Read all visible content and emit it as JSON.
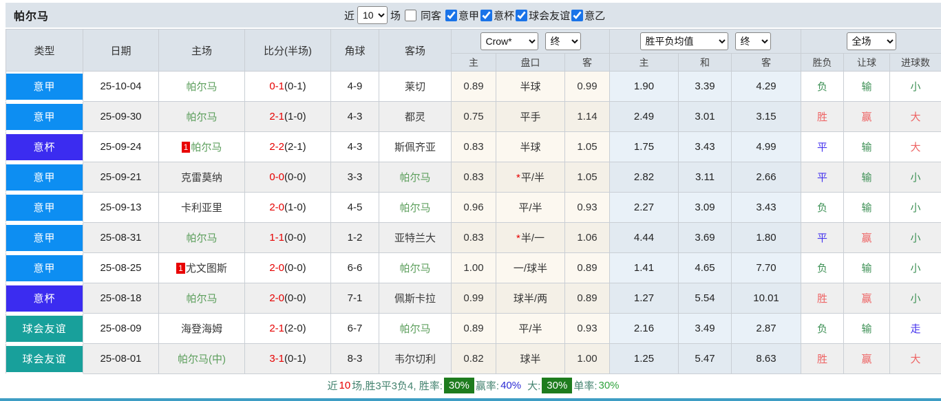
{
  "title": "帕尔马",
  "topbar": {
    "recent_label": "近",
    "recent_value": "10",
    "matches_label": "场",
    "same_away_label": "同客",
    "same_away_checked": false,
    "leagues": [
      {
        "label": "意甲",
        "checked": true
      },
      {
        "label": "意杯",
        "checked": true
      },
      {
        "label": "球会友谊",
        "checked": true
      },
      {
        "label": "意乙",
        "checked": true
      }
    ]
  },
  "table": {
    "selects": {
      "odds_source": "Crow*",
      "odds_time": "终",
      "avg_label": "胜平负均值",
      "avg_time": "终",
      "scope": "全场"
    },
    "headers": [
      "类型",
      "日期",
      "主场",
      "比分(半场)",
      "角球",
      "客场"
    ],
    "sub": [
      "主",
      "盘口",
      "客",
      "主",
      "和",
      "客",
      "胜负",
      "让球",
      "进球数"
    ],
    "rows": [
      {
        "type": "意甲",
        "type_color": "league_blue",
        "date": "25-10-04",
        "home": "帕尔马",
        "home_green": true,
        "home_badge": "",
        "score_ft": "0-1",
        "score_ht": "(0-1)",
        "corner": "4-9",
        "away": "莱切",
        "away_green": false,
        "odds_home": "0.89",
        "handicap": "半球",
        "handicap_star": false,
        "odds_away": "0.99",
        "avg_home": "1.90",
        "avg_draw": "3.39",
        "avg_away": "4.29",
        "result": "负",
        "result_color": "result_green",
        "let_result": "输",
        "let_color": "result_green",
        "goals": "小",
        "goals_color": "result_green"
      },
      {
        "type": "意甲",
        "type_color": "league_blue",
        "date": "25-09-30",
        "home": "帕尔马",
        "home_green": true,
        "home_badge": "",
        "score_ft": "2-1",
        "score_ht": "(1-0)",
        "corner": "4-3",
        "away": "都灵",
        "away_green": false,
        "odds_home": "0.75",
        "handicap": "平手",
        "handicap_star": false,
        "odds_away": "1.14",
        "avg_home": "2.49",
        "avg_draw": "3.01",
        "avg_away": "3.15",
        "result": "胜",
        "result_color": "result_red",
        "let_result": "赢",
        "let_color": "result_red",
        "goals": "大",
        "goals_color": "result_red"
      },
      {
        "type": "意杯",
        "type_color": "league_indigo",
        "date": "25-09-24",
        "home": "帕尔马",
        "home_green": true,
        "home_badge": "1",
        "score_ft": "2-2",
        "score_ht": "(2-1)",
        "corner": "4-3",
        "away": "斯佩齐亚",
        "away_green": false,
        "odds_home": "0.83",
        "handicap": "半球",
        "handicap_star": false,
        "odds_away": "1.05",
        "avg_home": "1.75",
        "avg_draw": "3.43",
        "avg_away": "4.99",
        "result": "平",
        "result_color": "result_blue",
        "let_result": "输",
        "let_color": "result_green",
        "goals": "大",
        "goals_color": "result_red"
      },
      {
        "type": "意甲",
        "type_color": "league_blue",
        "date": "25-09-21",
        "home": "克雷莫纳",
        "home_green": false,
        "home_badge": "",
        "score_ft": "0-0",
        "score_ht": "(0-0)",
        "corner": "3-3",
        "away": "帕尔马",
        "away_green": true,
        "odds_home": "0.83",
        "handicap": "平/半",
        "handicap_star": true,
        "odds_away": "1.05",
        "avg_home": "2.82",
        "avg_draw": "3.11",
        "avg_away": "2.66",
        "result": "平",
        "result_color": "result_blue",
        "let_result": "输",
        "let_color": "result_green",
        "goals": "小",
        "goals_color": "result_green"
      },
      {
        "type": "意甲",
        "type_color": "league_blue",
        "date": "25-09-13",
        "home": "卡利亚里",
        "home_green": false,
        "home_badge": "",
        "score_ft": "2-0",
        "score_ht": "(1-0)",
        "corner": "4-5",
        "away": "帕尔马",
        "away_green": true,
        "odds_home": "0.96",
        "handicap": "平/半",
        "handicap_star": false,
        "odds_away": "0.93",
        "avg_home": "2.27",
        "avg_draw": "3.09",
        "avg_away": "3.43",
        "result": "负",
        "result_color": "result_green",
        "let_result": "输",
        "let_color": "result_green",
        "goals": "小",
        "goals_color": "result_green"
      },
      {
        "type": "意甲",
        "type_color": "league_blue",
        "date": "25-08-31",
        "home": "帕尔马",
        "home_green": true,
        "home_badge": "",
        "score_ft": "1-1",
        "score_ht": "(0-0)",
        "corner": "1-2",
        "away": "亚特兰大",
        "away_green": false,
        "odds_home": "0.83",
        "handicap": "半/一",
        "handicap_star": true,
        "odds_away": "1.06",
        "avg_home": "4.44",
        "avg_draw": "3.69",
        "avg_away": "1.80",
        "result": "平",
        "result_color": "result_blue",
        "let_result": "赢",
        "let_color": "result_red",
        "goals": "小",
        "goals_color": "result_green"
      },
      {
        "type": "意甲",
        "type_color": "league_blue",
        "date": "25-08-25",
        "home": "尤文图斯",
        "home_green": false,
        "home_badge": "1",
        "score_ft": "2-0",
        "score_ht": "(0-0)",
        "corner": "6-6",
        "away": "帕尔马",
        "away_green": true,
        "odds_home": "1.00",
        "handicap": "一/球半",
        "handicap_star": false,
        "odds_away": "0.89",
        "avg_home": "1.41",
        "avg_draw": "4.65",
        "avg_away": "7.70",
        "result": "负",
        "result_color": "result_green",
        "let_result": "输",
        "let_color": "result_green",
        "goals": "小",
        "goals_color": "result_green"
      },
      {
        "type": "意杯",
        "type_color": "league_indigo",
        "date": "25-08-18",
        "home": "帕尔马",
        "home_green": true,
        "home_badge": "",
        "score_ft": "2-0",
        "score_ht": "(0-0)",
        "corner": "7-1",
        "away": "佩斯卡拉",
        "away_green": false,
        "odds_home": "0.99",
        "handicap": "球半/两",
        "handicap_star": false,
        "odds_away": "0.89",
        "avg_home": "1.27",
        "avg_draw": "5.54",
        "avg_away": "10.01",
        "result": "胜",
        "result_color": "result_red",
        "let_result": "赢",
        "let_color": "result_red",
        "goals": "小",
        "goals_color": "result_green"
      },
      {
        "type": "球会友谊",
        "type_color": "league_teal",
        "date": "25-08-09",
        "home": "海登海姆",
        "home_green": false,
        "home_badge": "",
        "score_ft": "2-1",
        "score_ht": "(2-0)",
        "corner": "6-7",
        "away": "帕尔马",
        "away_green": true,
        "odds_home": "0.89",
        "handicap": "平/半",
        "handicap_star": false,
        "odds_away": "0.93",
        "avg_home": "2.16",
        "avg_draw": "3.49",
        "avg_away": "2.87",
        "result": "负",
        "result_color": "result_green",
        "let_result": "输",
        "let_color": "result_green",
        "goals": "走",
        "goals_color": "result_blue"
      },
      {
        "type": "球会友谊",
        "type_color": "league_teal",
        "date": "25-08-01",
        "home": "帕尔马(中)",
        "home_green": true,
        "home_badge": "",
        "score_ft": "3-1",
        "score_ht": "(0-1)",
        "corner": "8-3",
        "away": "韦尔切利",
        "away_green": false,
        "odds_home": "0.82",
        "handicap": "球半",
        "handicap_star": false,
        "odds_away": "1.00",
        "avg_home": "1.25",
        "avg_draw": "5.47",
        "avg_away": "8.63",
        "result": "胜",
        "result_color": "result_red",
        "let_result": "赢",
        "let_color": "result_red",
        "goals": "大",
        "goals_color": "result_red"
      }
    ]
  },
  "footer": {
    "prefix": "近",
    "count": "10",
    "summary": "场,胜3平3负4, 胜率:",
    "win_rate": "30%",
    "handicap_label": "赢率:",
    "handicap_rate": "40%",
    "big_label": "大:",
    "big_rate": "30%",
    "single_label": "单率:",
    "single_rate": "30%"
  },
  "palette": {
    "league_blue": "#0d8ef2",
    "league_indigo": "#3b2cf0",
    "league_teal": "#18a09b",
    "team_green": "#5b9e5b",
    "team_dark": "#3a3a3a",
    "score_red": "#e60000",
    "result_red": "#ee6464",
    "result_green": "#3e9156",
    "result_blue": "#4432ee",
    "badge_green": "#1e7c1e",
    "footer_label": "#44836f",
    "footer_blue": "#2a2ad4",
    "footer_green": "#2fa33c",
    "bottom_line": "#3e9dc4",
    "header_bg": "#dce3ea"
  }
}
